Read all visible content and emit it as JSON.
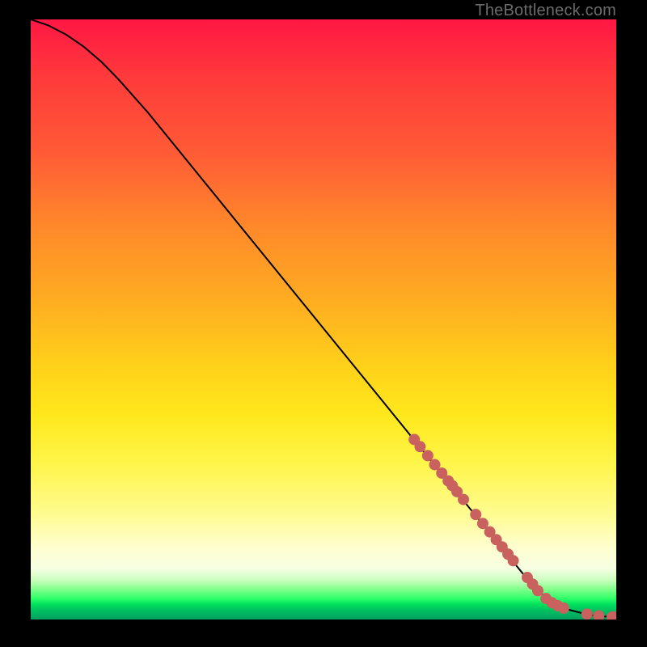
{
  "watermark": "TheBottleneck.com",
  "colors": {
    "curve": "#000000",
    "dots": "#c9625f",
    "dot_stroke": "#c9625f"
  },
  "chart_data": {
    "type": "line",
    "title": "",
    "xlabel": "",
    "ylabel": "",
    "xlim": [
      0,
      100
    ],
    "ylim": [
      0,
      100
    ],
    "grid": false,
    "series": [
      {
        "name": "curve",
        "x": [
          0,
          3,
          6,
          9,
          12,
          15,
          20,
          25,
          30,
          35,
          40,
          45,
          50,
          55,
          60,
          65,
          70,
          75,
          80,
          85,
          88,
          90,
          92,
          94,
          96,
          98,
          100
        ],
        "y": [
          100,
          99,
          97.5,
          95.5,
          93,
          90,
          84.5,
          78.5,
          72.5,
          66.5,
          60.5,
          54.5,
          48.5,
          42.5,
          36.5,
          30.5,
          24.5,
          18.5,
          12.5,
          6.5,
          3.6,
          2.4,
          1.6,
          1.1,
          0.7,
          0.5,
          0.4
        ]
      }
    ],
    "scatter_points": {
      "name": "dots",
      "x": [
        65.5,
        66.5,
        67.8,
        69.0,
        70.2,
        71.3,
        72.0,
        72.8,
        73.9,
        76.0,
        77.2,
        78.4,
        79.5,
        80.5,
        81.5,
        82.4,
        84.8,
        85.7,
        86.6,
        88.0,
        89.0,
        90.0,
        91.0,
        95.0,
        97.0,
        99.3,
        100.0
      ],
      "y": [
        30.0,
        28.8,
        27.3,
        25.8,
        24.4,
        23.1,
        22.3,
        21.3,
        20.0,
        17.5,
        16.0,
        14.6,
        13.3,
        12.1,
        10.9,
        9.8,
        7.0,
        5.9,
        4.8,
        3.5,
        2.8,
        2.3,
        1.9,
        0.9,
        0.6,
        0.4,
        0.4
      ]
    }
  }
}
